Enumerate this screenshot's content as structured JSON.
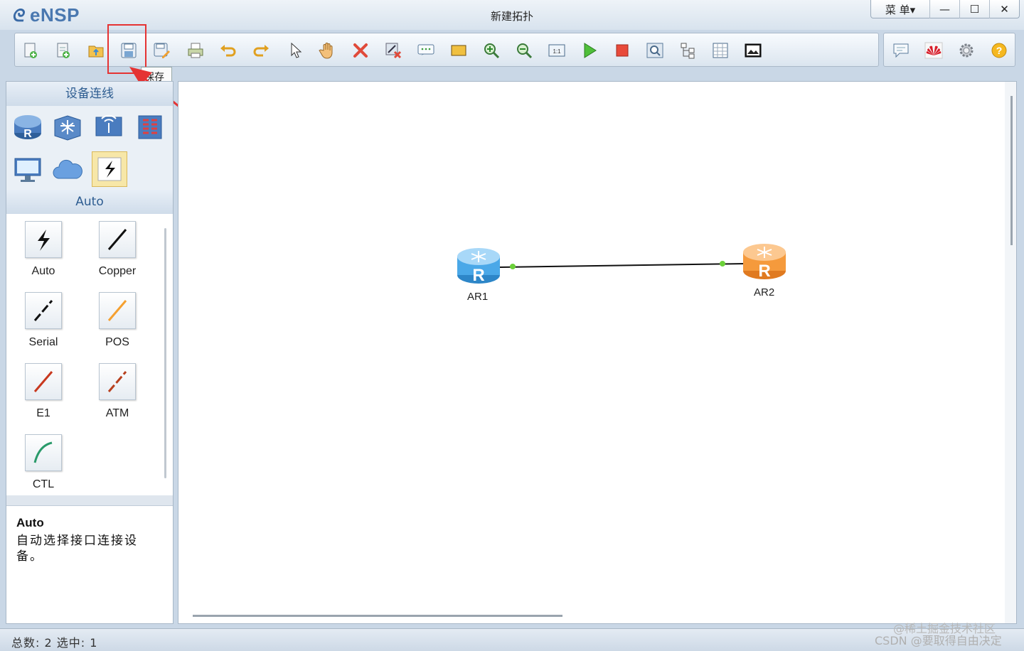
{
  "window": {
    "app_name": "eNSP",
    "title": "新建拓扑",
    "menu_label": "菜 单▾",
    "minimize_label": "—",
    "maximize_label": "☐",
    "close_label": "✕"
  },
  "toolbar": {
    "tooltip": "保存",
    "buttons": [
      "new-topology",
      "new-example",
      "open",
      "save",
      "save-as",
      "print",
      "undo",
      "redo",
      "select",
      "pan",
      "delete",
      "delete-all-links",
      "text-annotation",
      "rectangle",
      "zoom-in",
      "zoom-out",
      "fit-window",
      "start-devices",
      "stop-devices",
      "capture-data",
      "topology-view",
      "grid",
      "screenshot"
    ],
    "right_buttons": [
      "chat",
      "huawei-logo",
      "settings",
      "help"
    ]
  },
  "left_panel": {
    "device_header": "设备连线",
    "auto_header": "Auto",
    "devices": [
      "router",
      "switch",
      "wireless",
      "firewall",
      "pc",
      "cloud",
      "connection"
    ],
    "cables": [
      {
        "label": "Auto"
      },
      {
        "label": "Copper"
      },
      {
        "label": "Serial"
      },
      {
        "label": "POS"
      },
      {
        "label": "E1"
      },
      {
        "label": "ATM"
      },
      {
        "label": "CTL"
      }
    ],
    "description": {
      "title": "Auto",
      "text": "自动选择接口连接设备。"
    }
  },
  "canvas": {
    "routers": [
      {
        "name": "AR1",
        "color": "#4aa8e8"
      },
      {
        "name": "AR2",
        "color": "#f59a3c"
      }
    ],
    "link_status_color": "#6cd13a"
  },
  "status": {
    "text": "总数: 2 选中: 1"
  },
  "watermark": {
    "line1": "@稀土掘金技术社区",
    "line2": "CSDN @要取得自由决定"
  }
}
